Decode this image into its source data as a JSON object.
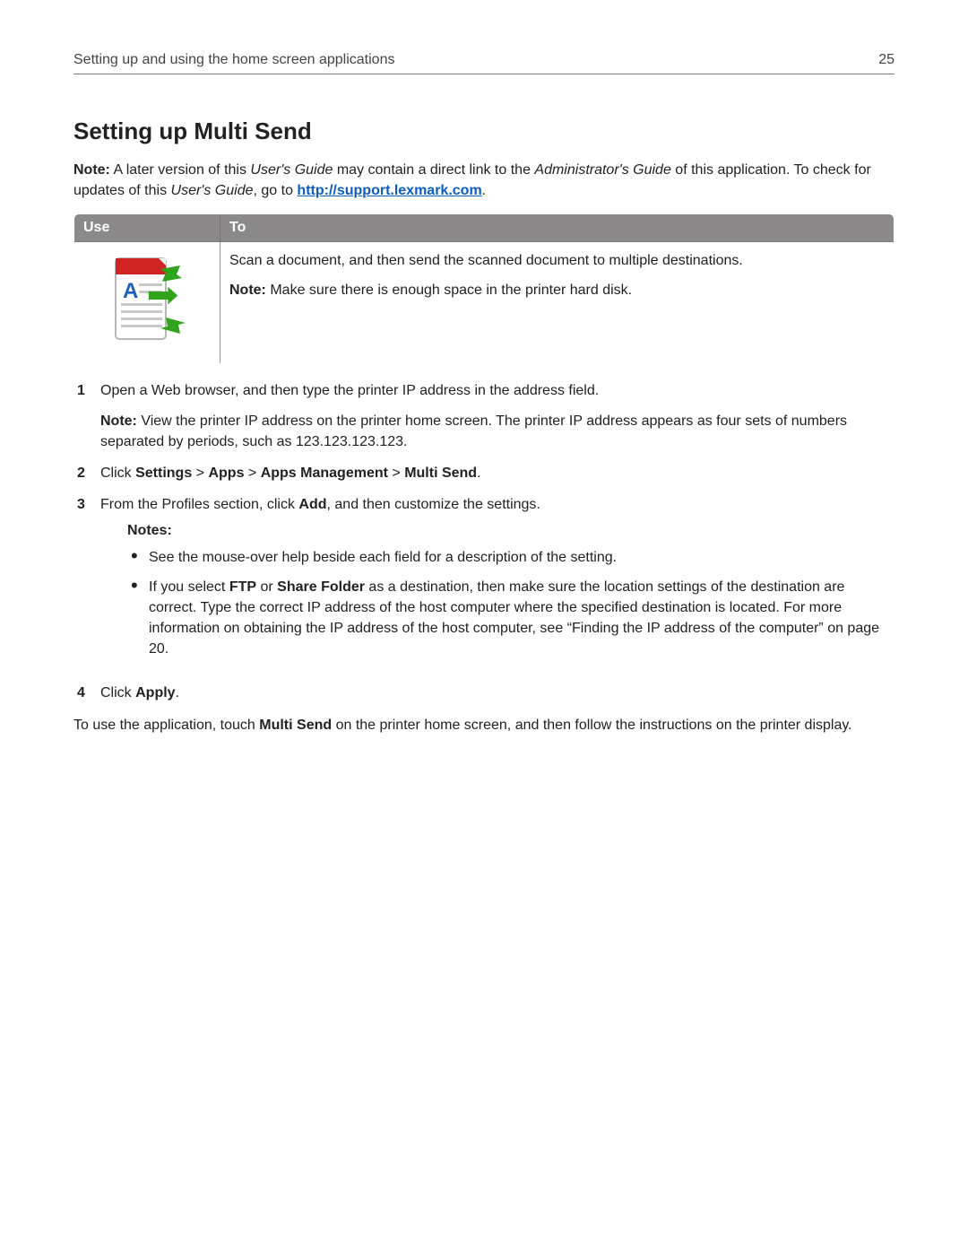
{
  "header": {
    "section_title": "Setting up and using the home screen applications",
    "page_number": "25"
  },
  "title": "Setting up Multi Send",
  "intro": {
    "note_label": "Note:",
    "s1": " A later version of this ",
    "i1": "User's Guide",
    "s2": " may contain a direct link to the ",
    "i2": "Administrator's Guide",
    "s3": " of this application. To check for updates of this ",
    "i3": "User's Guide",
    "s4": ", go to ",
    "link_text": "http://support.lexmark.com",
    "s5": "."
  },
  "table": {
    "h_use": "Use",
    "h_to": "To",
    "to_line1": "Scan a document, and then send the scanned document to multiple destinations.",
    "to_note_label": "Note:",
    "to_note_text": " Make sure there is enough space in the printer hard disk."
  },
  "steps": {
    "s1_text": "Open a Web browser, and then type the printer IP address in the address field.",
    "s1_note_label": "Note:",
    "s1_note_text": " View the printer IP address on the printer home screen. The printer IP address appears as four sets of numbers separated by periods, such as 123.123.123.123.",
    "s2_a": "Click ",
    "s2_b1": "Settings",
    "s2_sep": " > ",
    "s2_b2": "Apps",
    "s2_b3": "Apps Management",
    "s2_b4": "Multi Send",
    "s2_end": ".",
    "s3_a": "From the Profiles section, click ",
    "s3_b": "Add",
    "s3_c": ", and then customize the settings.",
    "s3_notes_label": "Notes:",
    "s3_bullet1": "See the mouse‑over help beside each field for a description of the setting.",
    "s3_bullet2_a": "If you select ",
    "s3_bullet2_b1": "FTP",
    "s3_bullet2_mid": " or ",
    "s3_bullet2_b2": "Share Folder",
    "s3_bullet2_c": " as a destination, then make sure the location settings of the destination are correct. Type the correct IP address of the host computer where the specified destination is located. For more information on obtaining the IP address of the host computer, see “Finding the IP address of the computer” on page 20.",
    "s4_a": "Click ",
    "s4_b": "Apply",
    "s4_c": "."
  },
  "closing_a": "To use the application, touch ",
  "closing_b": "Multi Send",
  "closing_c": " on the printer home screen, and then follow the instructions on the printer display."
}
